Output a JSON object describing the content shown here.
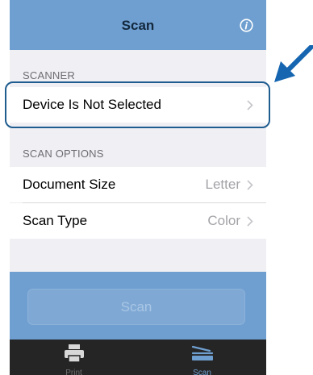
{
  "navbar": {
    "title": "Scan",
    "info_icon": "info-icon"
  },
  "scanner_section": {
    "header": "SCANNER",
    "device_row": {
      "label": "Device Is Not Selected"
    }
  },
  "scan_options_section": {
    "header": "SCAN OPTIONS",
    "rows": [
      {
        "label": "Document Size",
        "value": "Letter"
      },
      {
        "label": "Scan Type",
        "value": "Color"
      }
    ]
  },
  "actions": {
    "scan_button_label": "Scan"
  },
  "tabbar": {
    "tabs": [
      {
        "label": "Print",
        "icon": "printer-icon",
        "selected": false
      },
      {
        "label": "Scan",
        "icon": "scanner-icon",
        "selected": true
      }
    ]
  },
  "colors": {
    "accent": "#6f9fd0",
    "highlight_outline": "#1f5c8f",
    "arrow": "#1565b0",
    "tabbar": "#252525"
  }
}
